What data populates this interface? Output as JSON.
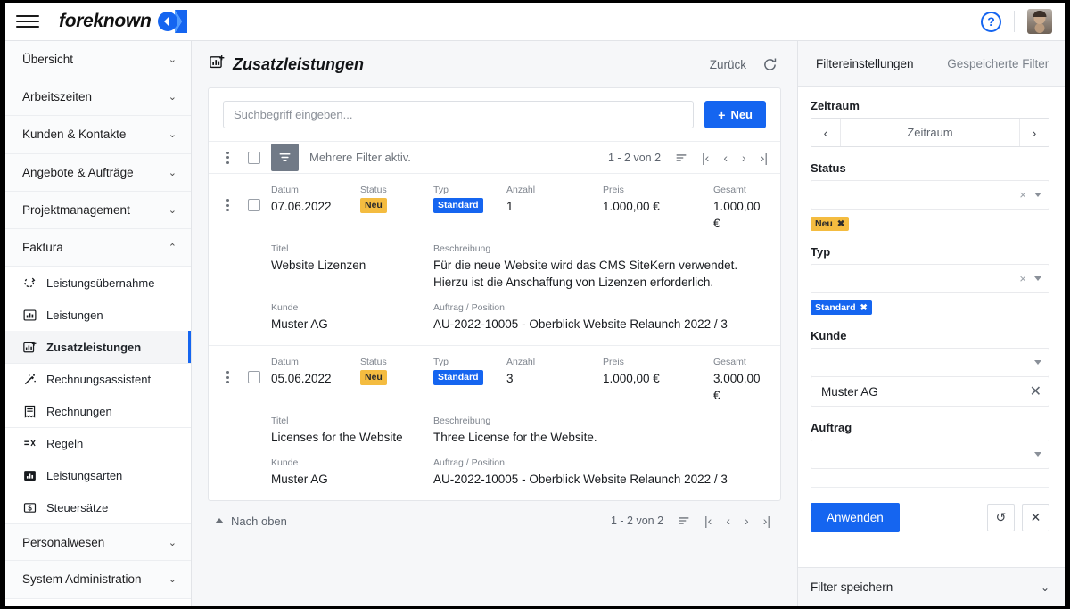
{
  "topbar": {
    "menu_icon": "hamburger-icon",
    "brand": "foreknown",
    "logo_icon": "foreknown-logo",
    "help_icon": "?",
    "help_name": "help-icon",
    "avatar_name": "user-avatar"
  },
  "sidebar": {
    "groups": [
      {
        "label": "Übersicht",
        "expanded": false,
        "chevron": "⌄"
      },
      {
        "label": "Arbeitszeiten",
        "expanded": false,
        "chevron": "⌄"
      },
      {
        "label": "Kunden & Kontakte",
        "expanded": false,
        "chevron": "⌄"
      },
      {
        "label": "Angebote & Aufträge",
        "expanded": false,
        "chevron": "⌄"
      },
      {
        "label": "Projektmanagement",
        "expanded": false,
        "chevron": "⌄"
      },
      {
        "label": "Faktura",
        "expanded": true,
        "chevron": "⌃"
      },
      {
        "label": "Personalwesen",
        "expanded": false,
        "chevron": "⌄"
      },
      {
        "label": "System Administration",
        "expanded": false,
        "chevron": "⌄"
      }
    ],
    "faktura_items": [
      {
        "label": "Leistungsübernahme",
        "icon": "transfer-service-icon",
        "active": false
      },
      {
        "label": "Leistungen",
        "icon": "chart-box-icon",
        "active": false
      },
      {
        "label": "Zusatzleistungen",
        "icon": "chart-box-plus-icon",
        "active": true
      },
      {
        "label": "Rechnungsassistent",
        "icon": "magic-wand-icon",
        "active": false
      },
      {
        "label": "Rechnungen",
        "icon": "invoice-icon",
        "active": false
      },
      {
        "label": "Regeln",
        "icon": "rules-icon",
        "active": false
      },
      {
        "label": "Leistungsarten",
        "icon": "bar-chart-icon",
        "active": false
      },
      {
        "label": "Steuersätze",
        "icon": "dollar-box-icon",
        "active": false
      }
    ]
  },
  "main": {
    "title": "Zusatzleistungen",
    "title_icon": "chart-box-plus-icon",
    "back_label": "Zurück",
    "refresh_icon": "refresh-icon",
    "search_placeholder": "Suchbegriff eingeben...",
    "search_value": "",
    "new_button": "Neu",
    "new_button_plus": "+",
    "toolbar": {
      "kebab_icon": "more-options-icon",
      "select_all_icon": "select-all-checkbox",
      "filter_icon": "filter-icon",
      "filter_status": "Mehrere Filter aktiv."
    },
    "pager": {
      "count": "1 - 2 von 2",
      "sort_icon": "sort-icon",
      "first_icon": "|‹",
      "prev_icon": "‹",
      "next_icon": "›",
      "last_icon": "›|"
    },
    "column_labels": {
      "datum": "Datum",
      "status": "Status",
      "typ": "Typ",
      "anzahl": "Anzahl",
      "preis": "Preis",
      "gesamt": "Gesamt",
      "titel": "Titel",
      "beschreibung": "Beschreibung",
      "kunde": "Kunde",
      "auftrag": "Auftrag / Position"
    },
    "rows": [
      {
        "datum": "07.06.2022",
        "status": "Neu",
        "typ": "Standard",
        "anzahl": "1",
        "preis": "1.000,00 €",
        "gesamt": "1.000,00 €",
        "titel": "Website Lizenzen",
        "beschreibung": "Für die neue Website wird das CMS SiteKern verwendet. Hierzu ist die Anschaffung von Lizenzen erforderlich.",
        "kunde": "Muster AG",
        "auftrag": "AU-2022-10005 - Oberblick Website Relaunch 2022 / 3"
      },
      {
        "datum": "05.06.2022",
        "status": "Neu",
        "typ": "Standard",
        "anzahl": "3",
        "preis": "1.000,00 €",
        "gesamt": "3.000,00 €",
        "titel": "Licenses for the Website",
        "beschreibung": "Three License for the Website.",
        "kunde": "Muster AG",
        "auftrag": "AU-2022-10005 - Oberblick Website Relaunch 2022 / 3"
      }
    ],
    "footer": {
      "top_label": "Nach oben",
      "top_icon": "caret-up-icon",
      "count": "1 - 2 von 2",
      "sort_icon": "sort-icon",
      "first_icon": "|‹",
      "prev_icon": "‹",
      "next_icon": "›",
      "last_icon": "›|"
    }
  },
  "filter_panel": {
    "tabs": [
      {
        "label": "Filtereinstellungen",
        "active": true
      },
      {
        "label": "Gespeicherte Filter",
        "active": false
      }
    ],
    "zeitraum": {
      "label": "Zeitraum",
      "value": "Zeitraum",
      "prev_icon": "‹",
      "next_icon": "›"
    },
    "status": {
      "label": "Status",
      "value": "",
      "clear_icon": "×",
      "chips": [
        {
          "label": "Neu",
          "remove_icon": "✖",
          "style": "neu"
        }
      ]
    },
    "typ": {
      "label": "Typ",
      "value": "",
      "clear_icon": "×",
      "chips": [
        {
          "label": "Standard",
          "remove_icon": "✖",
          "style": "std"
        }
      ]
    },
    "kunde": {
      "label": "Kunde",
      "value": "",
      "selected": "Muster AG",
      "remove_icon": "✕"
    },
    "auftrag": {
      "label": "Auftrag",
      "value": ""
    },
    "apply_button": "Anwenden",
    "reset_icon": "↺",
    "clear_icon": "✕",
    "save_filter_label": "Filter speichern",
    "save_filter_chevron": "⌄"
  },
  "colors": {
    "accent": "#1565f0",
    "badge_new": "#f4bc40",
    "badge_standard": "#1565f0",
    "page_bg": "#f6f7f9",
    "border": "#e4e6ea"
  }
}
